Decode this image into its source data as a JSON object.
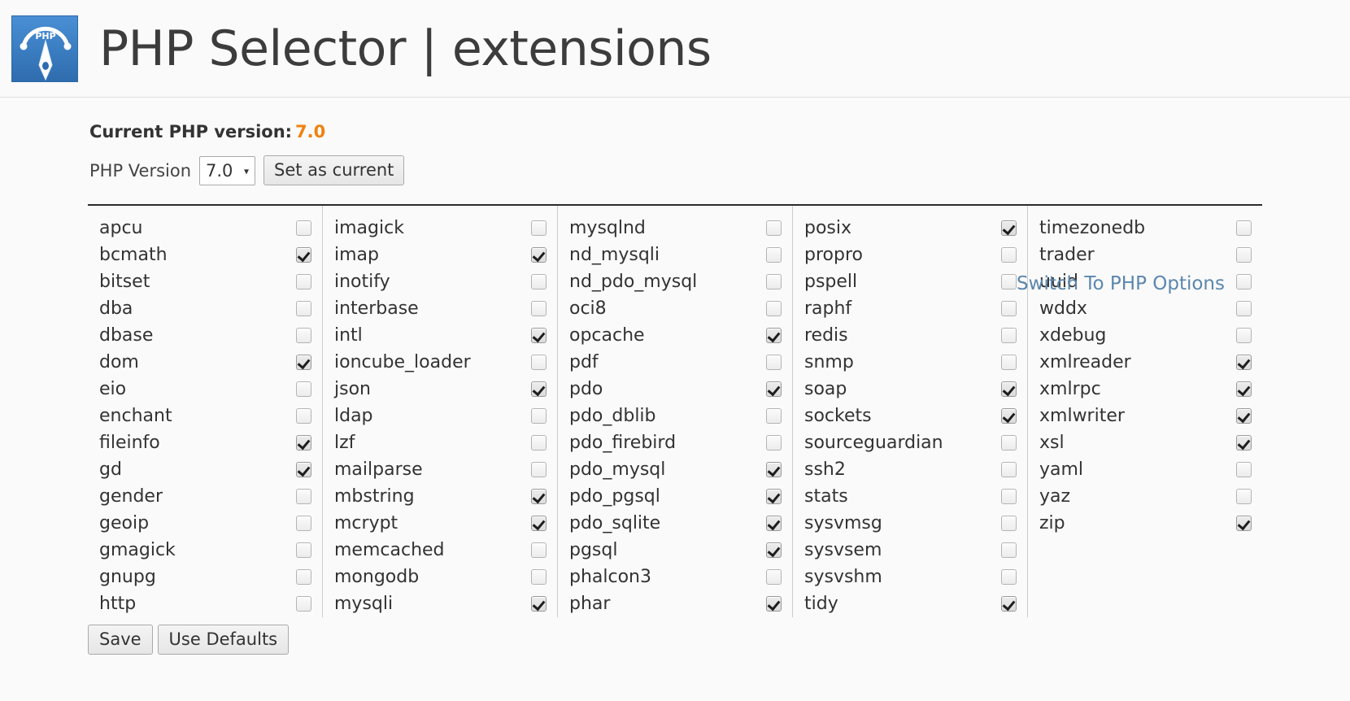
{
  "header": {
    "logo_icon": "php-gauge-logo",
    "title": "PHP Selector | extensions"
  },
  "version_panel": {
    "current_label": "Current PHP version:",
    "current_value": "7.0",
    "current_value_color": "#f0820f",
    "version_field_label": "PHP Version",
    "selected_version": "7.0",
    "version_options": [
      "7.0"
    ],
    "set_as_current_label": "Set as current",
    "switch_link_label": "Switch To PHP Options",
    "switch_link_color": "#5b87ad"
  },
  "footer": {
    "save_label": "Save",
    "use_defaults_label": "Use Defaults"
  },
  "extensions": {
    "columns": [
      [
        {
          "name": "apcu",
          "checked": false
        },
        {
          "name": "bcmath",
          "checked": true
        },
        {
          "name": "bitset",
          "checked": false
        },
        {
          "name": "dba",
          "checked": false
        },
        {
          "name": "dbase",
          "checked": false
        },
        {
          "name": "dom",
          "checked": true
        },
        {
          "name": "eio",
          "checked": false
        },
        {
          "name": "enchant",
          "checked": false
        },
        {
          "name": "fileinfo",
          "checked": true
        },
        {
          "name": "gd",
          "checked": true
        },
        {
          "name": "gender",
          "checked": false
        },
        {
          "name": "geoip",
          "checked": false
        },
        {
          "name": "gmagick",
          "checked": false
        },
        {
          "name": "gnupg",
          "checked": false
        },
        {
          "name": "http",
          "checked": false
        }
      ],
      [
        {
          "name": "imagick",
          "checked": false
        },
        {
          "name": "imap",
          "checked": true
        },
        {
          "name": "inotify",
          "checked": false
        },
        {
          "name": "interbase",
          "checked": false
        },
        {
          "name": "intl",
          "checked": true
        },
        {
          "name": "ioncube_loader",
          "checked": false
        },
        {
          "name": "json",
          "checked": true
        },
        {
          "name": "ldap",
          "checked": false
        },
        {
          "name": "lzf",
          "checked": false
        },
        {
          "name": "mailparse",
          "checked": false
        },
        {
          "name": "mbstring",
          "checked": true
        },
        {
          "name": "mcrypt",
          "checked": true
        },
        {
          "name": "memcached",
          "checked": false
        },
        {
          "name": "mongodb",
          "checked": false
        },
        {
          "name": "mysqli",
          "checked": true
        }
      ],
      [
        {
          "name": "mysqlnd",
          "checked": false
        },
        {
          "name": "nd_mysqli",
          "checked": false
        },
        {
          "name": "nd_pdo_mysql",
          "checked": false
        },
        {
          "name": "oci8",
          "checked": false
        },
        {
          "name": "opcache",
          "checked": true
        },
        {
          "name": "pdf",
          "checked": false
        },
        {
          "name": "pdo",
          "checked": true
        },
        {
          "name": "pdo_dblib",
          "checked": false
        },
        {
          "name": "pdo_firebird",
          "checked": false
        },
        {
          "name": "pdo_mysql",
          "checked": true
        },
        {
          "name": "pdo_pgsql",
          "checked": true
        },
        {
          "name": "pdo_sqlite",
          "checked": true
        },
        {
          "name": "pgsql",
          "checked": true
        },
        {
          "name": "phalcon3",
          "checked": false
        },
        {
          "name": "phar",
          "checked": true
        }
      ],
      [
        {
          "name": "posix",
          "checked": true
        },
        {
          "name": "propro",
          "checked": false
        },
        {
          "name": "pspell",
          "checked": false
        },
        {
          "name": "raphf",
          "checked": false
        },
        {
          "name": "redis",
          "checked": false
        },
        {
          "name": "snmp",
          "checked": false
        },
        {
          "name": "soap",
          "checked": true
        },
        {
          "name": "sockets",
          "checked": true
        },
        {
          "name": "sourceguardian",
          "checked": false
        },
        {
          "name": "ssh2",
          "checked": false
        },
        {
          "name": "stats",
          "checked": false
        },
        {
          "name": "sysvmsg",
          "checked": false
        },
        {
          "name": "sysvsem",
          "checked": false
        },
        {
          "name": "sysvshm",
          "checked": false
        },
        {
          "name": "tidy",
          "checked": true
        }
      ],
      [
        {
          "name": "timezonedb",
          "checked": false
        },
        {
          "name": "trader",
          "checked": false
        },
        {
          "name": "uuid",
          "checked": false
        },
        {
          "name": "wddx",
          "checked": false
        },
        {
          "name": "xdebug",
          "checked": false
        },
        {
          "name": "xmlreader",
          "checked": true
        },
        {
          "name": "xmlrpc",
          "checked": true
        },
        {
          "name": "xmlwriter",
          "checked": true
        },
        {
          "name": "xsl",
          "checked": true
        },
        {
          "name": "yaml",
          "checked": false
        },
        {
          "name": "yaz",
          "checked": false
        },
        {
          "name": "zip",
          "checked": true
        }
      ]
    ]
  }
}
